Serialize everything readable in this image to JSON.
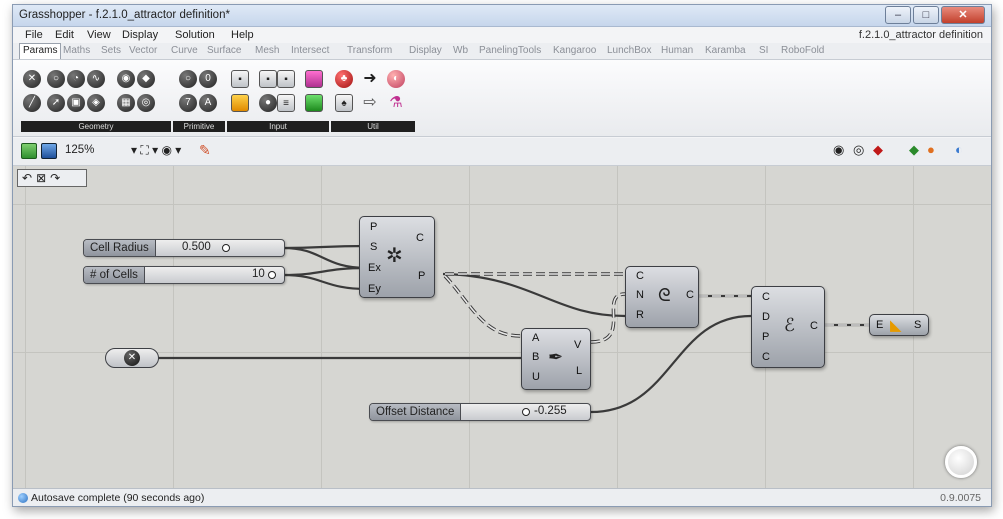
{
  "window": {
    "title": "Grasshopper - f.2.1.0_attractor definition*",
    "doc_name": "f.2.1.0_attractor definition"
  },
  "menu": [
    "File",
    "Edit",
    "View",
    "Display",
    "Solution",
    "Help"
  ],
  "tabs": [
    "Params",
    "Maths",
    "Sets",
    "Vector",
    "Curve",
    "Surface",
    "Mesh",
    "Intersect",
    "Transform",
    "Display",
    "Wb",
    "PanelingTools",
    "Kangaroo",
    "LunchBox",
    "Human",
    "Karamba",
    "SI",
    "RoboFold"
  ],
  "ribbon_groups": [
    "Geometry",
    "Primitive",
    "Input",
    "Util"
  ],
  "toolbar": {
    "zoom": "125%"
  },
  "canvas": {
    "sliders": {
      "cell_radius": {
        "name": "Cell Radius",
        "value": "0.500"
      },
      "num_cells": {
        "name": "# of Cells",
        "value": "10"
      },
      "offset": {
        "name": "Offset Distance",
        "value": "-0.255"
      }
    },
    "hex_grid": {
      "inputs": [
        "P",
        "S",
        "Ex",
        "Ey"
      ],
      "outputs": [
        "C",
        "P"
      ]
    },
    "closest": {
      "inputs": [
        "A",
        "B",
        "U"
      ],
      "outputs": [
        "V",
        "L"
      ]
    },
    "circle": {
      "inputs": [
        "C",
        "N",
        "R"
      ],
      "outputs": [
        "C"
      ]
    },
    "offset": {
      "inputs": [
        "C",
        "D",
        "P",
        "C"
      ],
      "outputs": [
        "C"
      ]
    },
    "surface": {
      "inputs": [
        "E"
      ],
      "outputs": [
        "S"
      ]
    }
  },
  "status": {
    "message": "Autosave complete (90 seconds ago)",
    "version": "0.9.0075"
  }
}
